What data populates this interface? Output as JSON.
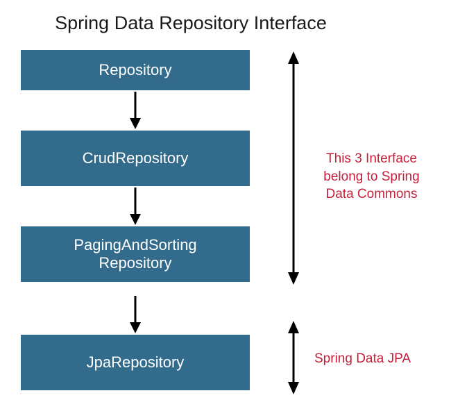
{
  "title": "Spring Data Repository Interface",
  "boxes": {
    "repository": "Repository",
    "crud": "CrudRepository",
    "paging_line1": "PagingAndSorting",
    "paging_line2": "Repository",
    "jpa": "JpaRepository"
  },
  "annotations": {
    "commons": "This 3 Interface belong to Spring Data Commons",
    "jpa": "Spring Data JPA"
  },
  "colors": {
    "box_bg": "#336b8c",
    "box_text": "#ffffff",
    "annotation_text": "#c41e3a",
    "arrow": "#000000"
  }
}
